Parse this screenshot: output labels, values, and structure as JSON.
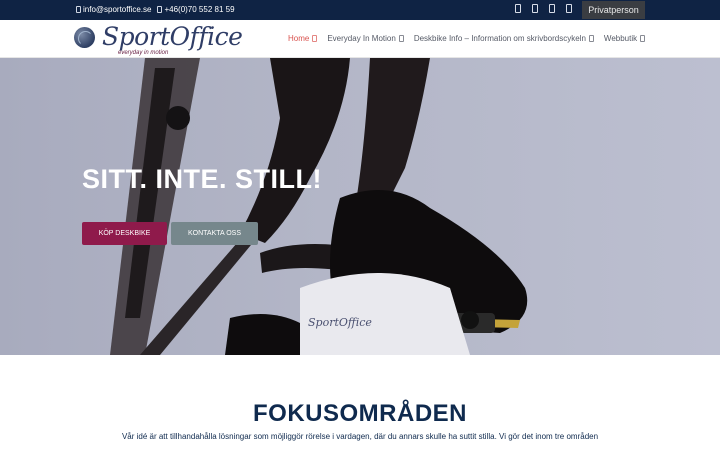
{
  "topbar": {
    "email": "info@sportoffice.se",
    "phone": "+46(0)70 552 81 59",
    "social_icons": [
      "facebook-icon",
      "instagram-icon",
      "linkedin-icon",
      "youtube-icon"
    ],
    "privatperson_label": "Privatperson"
  },
  "header": {
    "logo_text": "SportOffice",
    "logo_tagline": "everyday in motion",
    "nav": [
      {
        "label": "Home",
        "active": true
      },
      {
        "label": "Everyday In Motion",
        "active": false
      },
      {
        "label": "Deskbike Info – Information om skrivbordscykeln",
        "active": false
      },
      {
        "label": "Webbutik",
        "active": false
      }
    ]
  },
  "hero": {
    "title": "SITT. INTE. STILL!",
    "buy_button": "KÖP DESKBIKE",
    "contact_button": "KONTAKTA OSS",
    "watermark": "SportOffice"
  },
  "focus": {
    "title": "FOKUSOMRÅDEN",
    "text": "Vår idé är att tillhandahålla lösningar som möjliggör rörelse i vardagen, där du annars skulle ha suttit stilla. Vi gör det inom tre områden"
  },
  "colors": {
    "topbar": "#0f2344",
    "accent_nav": "#d9534f",
    "buy_button": "#8f1a4b",
    "contact_button": "#76878c",
    "heading": "#0f2a4e"
  }
}
